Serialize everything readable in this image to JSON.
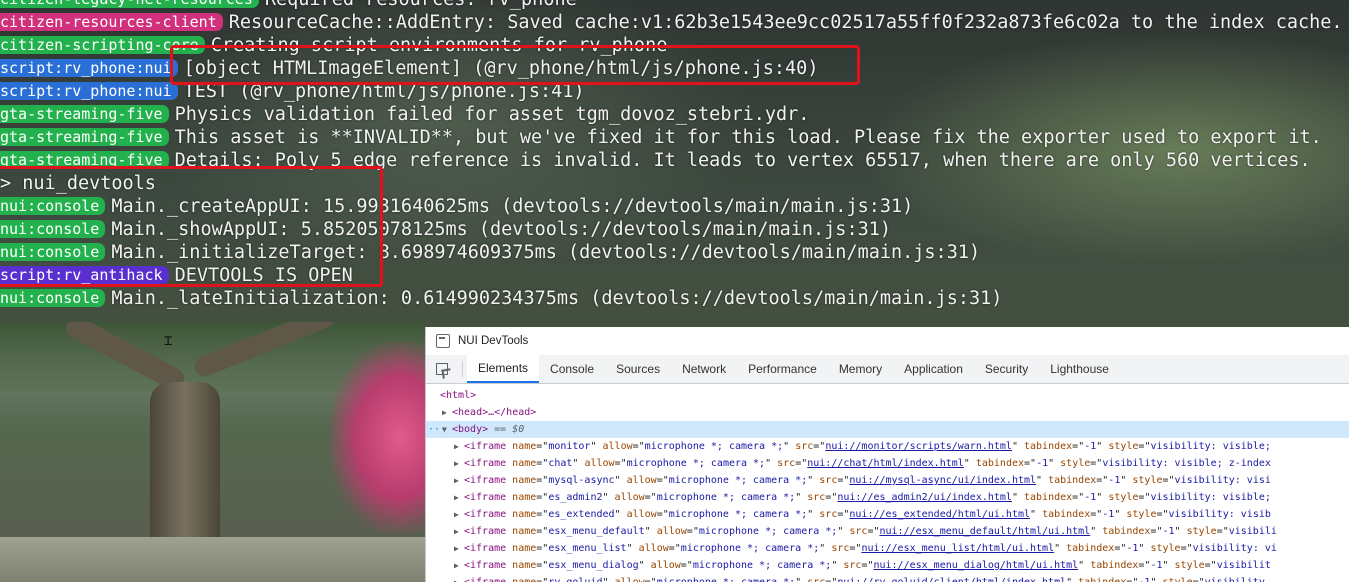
{
  "console": {
    "lines": [
      {
        "tag": "citizen-legacy-net-resources",
        "tag_color": "#22b14c",
        "text": "Required resources: rv_phone"
      },
      {
        "tag": "citizen-resources-client",
        "tag_color": "#d1307c",
        "text": "ResourceCache::AddEntry: Saved cache:v1:62b3e1543ee9cc02517a55ff0f232a873fe6c02a to the index cache."
      },
      {
        "tag": "citizen-scripting-core",
        "tag_color": "#22b14c",
        "text": "Creating script environments for rv_phone"
      },
      {
        "tag": "script:rv_phone:nui",
        "tag_color": "#2a6fd6",
        "text": "[object HTMLImageElement] (@rv_phone/html/js/phone.js:40)"
      },
      {
        "tag": "script:rv_phone:nui",
        "tag_color": "#2a6fd6",
        "text": "TEST (@rv_phone/html/js/phone.js:41)"
      },
      {
        "tag": "gta-streaming-five",
        "tag_color": "#22b14c",
        "text": "Physics validation failed for asset tgm_dovoz_stebri.ydr."
      },
      {
        "tag": "gta-streaming-five",
        "tag_color": "#22b14c",
        "text": "This asset is **INVALID**, but we've fixed it for this load. Please fix the exporter used to export it."
      },
      {
        "tag": "gta-streaming-five",
        "tag_color": "#22b14c",
        "text": "Details: Poly 5 edge reference is invalid. It leads to vertex 65517, when there are only 560 vertices."
      },
      {
        "tag": "",
        "tag_color": "",
        "text": "> nui_devtools"
      },
      {
        "tag": "nui:console",
        "tag_color": "#22b14c",
        "text": "Main._createAppUI: 15.9931640625ms (devtools://devtools/main/main.js:31)"
      },
      {
        "tag": "nui:console",
        "tag_color": "#22b14c",
        "text": "Main._showAppUI: 5.85205078125ms (devtools://devtools/main/main.js:31)"
      },
      {
        "tag": "nui:console",
        "tag_color": "#22b14c",
        "text": "Main._initializeTarget: 8.698974609375ms (devtools://devtools/main/main.js:31)"
      },
      {
        "tag": "script:rv_antihack",
        "tag_color": "#5a2fcf",
        "text": "DEVTOOLS IS OPEN"
      },
      {
        "tag": "nui:console",
        "tag_color": "#22b14c",
        "text": "Main._lateInitialization: 0.614990234375ms (devtools://devtools/main/main.js:31)"
      }
    ]
  },
  "devtools": {
    "title": "NUI DevTools",
    "tabs": [
      "Elements",
      "Console",
      "Sources",
      "Network",
      "Performance",
      "Memory",
      "Application",
      "Security",
      "Lighthouse"
    ],
    "active_tab": "Elements",
    "dom": {
      "html": "<html>",
      "head": "<head>…</head>",
      "body_open": "<body>",
      "body_meta": "== $0",
      "iframes": [
        {
          "name": "monitor",
          "src": "nui://monitor/scripts/warn.html",
          "tail": "visibility: visible;"
        },
        {
          "name": "chat",
          "src": "nui://chat/html/index.html",
          "tail": "visibility: visible; z-index"
        },
        {
          "name": "mysql-async",
          "src": "nui://mysql-async/ui/index.html",
          "tail": "visibility: visi"
        },
        {
          "name": "es_admin2",
          "src": "nui://es_admin2/ui/index.html",
          "tail": "visibility: visible;"
        },
        {
          "name": "es_extended",
          "src": "nui://es_extended/html/ui.html",
          "tail": "visibility: visib"
        },
        {
          "name": "esx_menu_default",
          "src": "nui://esx_menu_default/html/ui.html",
          "tail": "visibili"
        },
        {
          "name": "esx_menu_list",
          "src": "nui://esx_menu_list/html/ui.html",
          "tail": "visibility: vi"
        },
        {
          "name": "esx_menu_dialog",
          "src": "nui://esx_menu_dialog/html/ui.html",
          "tail": "visibilit"
        },
        {
          "name": "rv_goluid",
          "src": "nui://rv_goluid/client/html/index.html",
          "tail": "visibility"
        }
      ],
      "allow": "microphone *; camera *;",
      "tabindex": "-1"
    }
  },
  "colors": {
    "highlight_border": "#e0121c",
    "devtools_active_tab": "#1a73e8"
  }
}
